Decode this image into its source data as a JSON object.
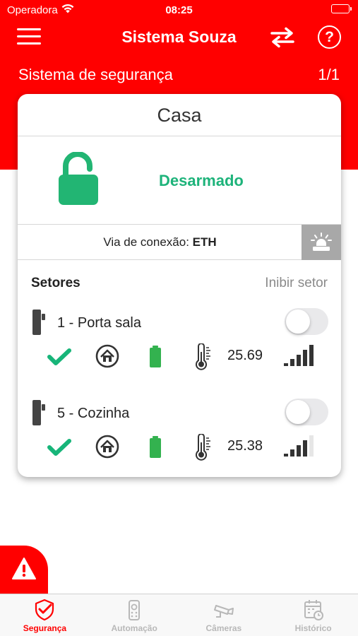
{
  "status_bar": {
    "carrier": "Operadora",
    "time": "08:25"
  },
  "nav": {
    "title": "Sistema Souza"
  },
  "section": {
    "title": "Sistema de segurança",
    "counter": "1/1"
  },
  "card": {
    "title": "Casa",
    "arm_status": "Desarmado",
    "connection_label": "Via de conexão:",
    "connection_value": "ETH",
    "sectors_label": "Setores",
    "inhibit_label": "Inibir setor"
  },
  "sectors": [
    {
      "name": "1 - Porta sala",
      "temperature": "25.69",
      "signal_bars": 5,
      "inhibited": false
    },
    {
      "name": "5 - Cozinha",
      "temperature": "25.38",
      "signal_bars": 4,
      "inhibited": false
    }
  ],
  "tabs": [
    {
      "label": "Segurança",
      "icon": "shield-check-icon",
      "active": true
    },
    {
      "label": "Automação",
      "icon": "remote-control-icon",
      "active": false
    },
    {
      "label": "Câmeras",
      "icon": "camera-icon",
      "active": false
    },
    {
      "label": "Histórico",
      "icon": "calendar-clock-icon",
      "active": false
    }
  ],
  "colors": {
    "brand_red": "#ff0000",
    "armed_status_green": "#1db37a",
    "lock_green": "#22b573",
    "check_green": "#17b579",
    "battery_green": "#33b24f",
    "inactive_gray": "#b8b8b8"
  }
}
